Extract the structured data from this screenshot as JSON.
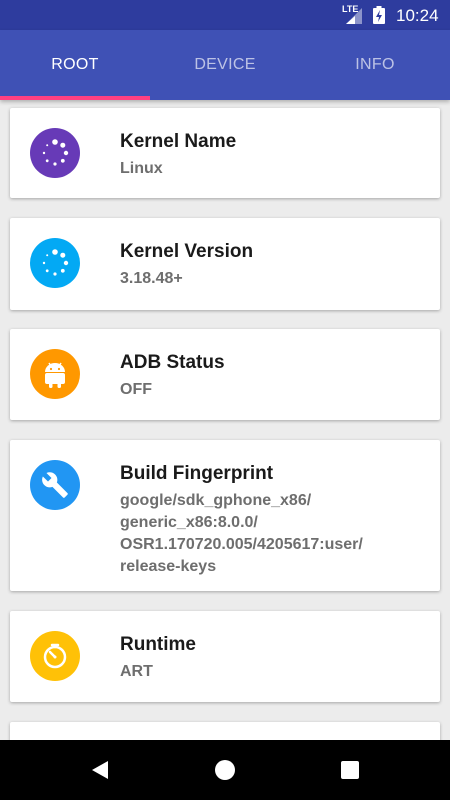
{
  "status_bar": {
    "network": "LTE",
    "time": "10:24"
  },
  "tabs": [
    {
      "label": "ROOT",
      "active": true
    },
    {
      "label": "DEVICE",
      "active": false
    },
    {
      "label": "INFO",
      "active": false
    }
  ],
  "colors": {
    "primary": "#3f51b5",
    "primary_dark": "#2e3c9e",
    "accent": "#ff4081"
  },
  "cards": [
    {
      "title": "Kernel Name",
      "value": "Linux",
      "icon": "loader-dots-icon",
      "icon_color": "#673ab7"
    },
    {
      "title": "Kernel Version",
      "value": "3.18.48+",
      "icon": "loader-dots-icon",
      "icon_color": "#03a9f4"
    },
    {
      "title": "ADB Status",
      "value": "OFF",
      "icon": "android-icon",
      "icon_color": "#ff9800"
    },
    {
      "title": "Build Fingerprint",
      "value": "google/sdk_gphone_x86/\ngeneric_x86:8.0.0/\nOSR1.170720.005/4205617:user/\nrelease-keys",
      "icon": "wrench-icon",
      "icon_color": "#2196f3"
    },
    {
      "title": "Runtime",
      "value": "ART",
      "icon": "timer-icon",
      "icon_color": "#ffc107"
    }
  ],
  "nav": {
    "back": "back-icon",
    "home": "home-icon",
    "recent": "recents-icon"
  }
}
